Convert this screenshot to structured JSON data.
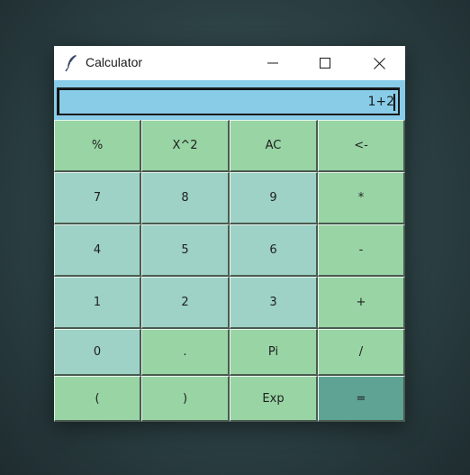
{
  "window": {
    "title": "Calculator",
    "icon": "feather-icon",
    "controls": [
      "minimize-icon",
      "maximize-icon",
      "close-icon"
    ]
  },
  "display": {
    "value": "1+2"
  },
  "buttons": {
    "percent": "%",
    "square": "X^2",
    "clear": "AC",
    "backspace": "<-",
    "seven": "7",
    "eight": "8",
    "nine": "9",
    "multiply": "*",
    "four": "4",
    "five": "5",
    "six": "6",
    "subtract": "-",
    "one": "1",
    "two": "2",
    "three": "3",
    "add": "+",
    "zero": "0",
    "decimal": ".",
    "pi": "Pi",
    "divide": "/",
    "open_paren": "(",
    "close_paren": ")",
    "exp": "Exp",
    "equals": "="
  },
  "colors": {
    "display_bg": "#88cce8",
    "operator_button": "#98d4a4",
    "number_button": "#9ed2c6",
    "equals_button": "#5ea394"
  }
}
